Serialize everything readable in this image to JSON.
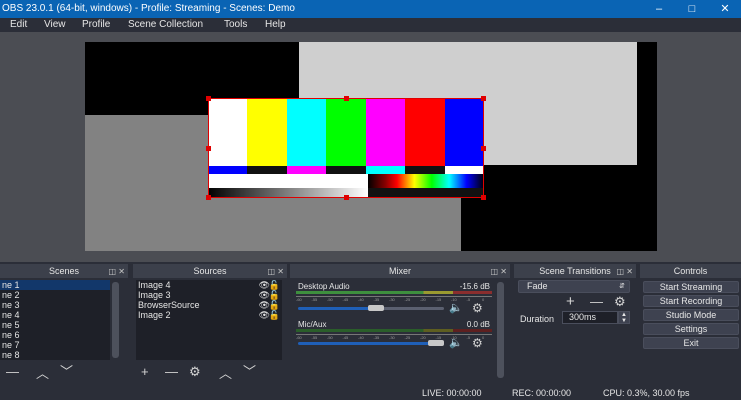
{
  "window": {
    "title": "OBS 23.0.1 (64-bit, windows) - Profile: Streaming - Scenes: Demo",
    "minimize_icon": "minimize-icon",
    "maximize_icon": "maximize-icon",
    "close_icon": "close-icon"
  },
  "menu": [
    "Edit",
    "View",
    "Profile",
    "Scene Collection",
    "Tools",
    "Help"
  ],
  "preview": {
    "colors": {
      "selection": "#e00000",
      "background": "#4b4d53"
    },
    "color_bars": [
      "#ffffff",
      "#ffff00",
      "#00ffff",
      "#00ff00",
      "#ff00ff",
      "#ff0000",
      "#0000ff"
    ]
  },
  "scenes": {
    "title": "Scenes",
    "items": [
      "ne 1",
      "ne 2",
      "ne 3",
      "ne 4",
      "ne 5",
      "ne 6",
      "ne 7",
      "ne 8"
    ],
    "selected": 0,
    "toolbar": {
      "remove": "—",
      "up": "︿",
      "down": "﹀"
    }
  },
  "sources": {
    "title": "Sources",
    "items": [
      {
        "name": "Image 4",
        "visible": true,
        "locked": false
      },
      {
        "name": "Image 3",
        "visible": true,
        "locked": false
      },
      {
        "name": "BrowserSource",
        "visible": true,
        "locked": false
      },
      {
        "name": "Image 2",
        "visible": true,
        "locked": false
      }
    ],
    "toolbar": {
      "add": "+",
      "remove": "—",
      "settings": "⚙",
      "up": "︿",
      "down": "﹀"
    }
  },
  "mixer": {
    "title": "Mixer",
    "channels": [
      {
        "name": "Desktop Audio",
        "db": "-15.6 dB",
        "volume": 0.4
      },
      {
        "name": "Mic/Aux",
        "db": "0.0 dB",
        "volume": 1.0
      }
    ]
  },
  "transitions": {
    "title": "Scene Transitions",
    "selected": "Fade",
    "duration_label": "Duration",
    "duration_value": "300ms",
    "add": "+",
    "remove": "—",
    "settings": "⚙"
  },
  "controls": {
    "title": "Controls",
    "buttons": [
      "Start Streaming",
      "Start Recording",
      "Studio Mode",
      "Settings",
      "Exit"
    ]
  },
  "status": {
    "live": "LIVE: 00:00:00",
    "rec": "REC: 00:00:00",
    "cpu": "CPU: 0.3%, 30.00 fps"
  }
}
